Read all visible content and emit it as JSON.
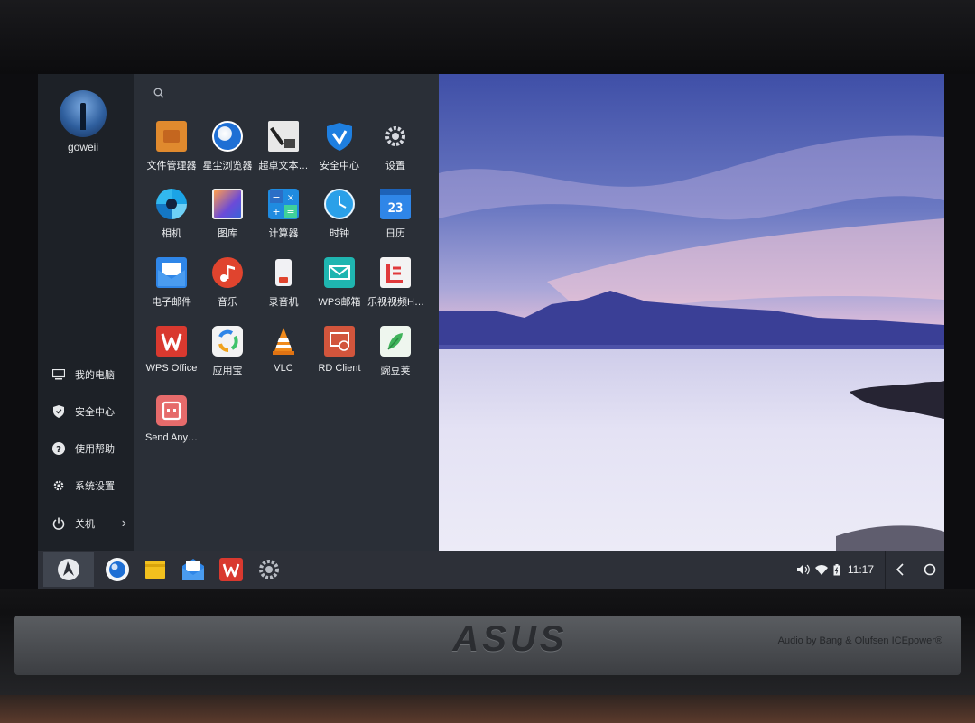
{
  "user": {
    "name": "goweii"
  },
  "apps": [
    {
      "label": "文件管理器",
      "icon": "folder-icon",
      "color": "#e08a2e"
    },
    {
      "label": "星尘浏览器",
      "icon": "globe-icon",
      "color": "#1e6fd4"
    },
    {
      "label": "超卓文本…",
      "icon": "text-editor-icon",
      "color": "#e8e8e8"
    },
    {
      "label": "安全中心",
      "icon": "shield-icon",
      "color": "#1e7fe0"
    },
    {
      "label": "设置",
      "icon": "gear-icon",
      "color": "#3a3f47"
    },
    {
      "label": "相机",
      "icon": "camera-icon",
      "color": "#1ba4e6"
    },
    {
      "label": "图库",
      "icon": "gallery-icon",
      "color": "#6b4bd8"
    },
    {
      "label": "计算器",
      "icon": "calculator-icon",
      "color": "#1f8be0"
    },
    {
      "label": "时钟",
      "icon": "clock-icon",
      "color": "#2aa0e8"
    },
    {
      "label": "日历",
      "icon": "calendar-icon",
      "color": "#2f86e8"
    },
    {
      "label": "电子邮件",
      "icon": "mail-icon",
      "color": "#2f86e8"
    },
    {
      "label": "音乐",
      "icon": "music-icon",
      "color": "#e0442e"
    },
    {
      "label": "录音机",
      "icon": "recorder-icon",
      "color": "#e8e8ee"
    },
    {
      "label": "WPS邮箱",
      "icon": "wps-mail-icon",
      "color": "#1fb5b0"
    },
    {
      "label": "乐视视频H…",
      "icon": "letv-icon",
      "color": "#f3f3f3"
    },
    {
      "label": "WPS Office",
      "icon": "wps-office-icon",
      "color": "#d9392f"
    },
    {
      "label": "应用宝",
      "icon": "app-store-icon",
      "color": "#f3f3f3"
    },
    {
      "label": "VLC",
      "icon": "vlc-cone-icon",
      "color": "#f08a1c"
    },
    {
      "label": "RD Client",
      "icon": "remote-desktop-icon",
      "color": "#d2553c"
    },
    {
      "label": "豌豆荚",
      "icon": "wandoujia-icon",
      "color": "#eef6ee"
    },
    {
      "label": "Send Any…",
      "icon": "send-anywhere-icon",
      "color": "#e66b6b"
    }
  ],
  "sidebar": {
    "items": [
      {
        "label": "我的电脑",
        "icon": "computer-icon"
      },
      {
        "label": "安全中心",
        "icon": "shield-icon"
      },
      {
        "label": "使用帮助",
        "icon": "help-icon"
      },
      {
        "label": "系统设置",
        "icon": "gear-icon"
      },
      {
        "label": "关机",
        "icon": "power-icon"
      }
    ]
  },
  "taskbar": {
    "pinned": [
      "globe-icon",
      "folder-icon",
      "mail-icon",
      "wps-office-icon",
      "gear-icon"
    ],
    "time": "11:17"
  },
  "bezel": {
    "brand": "ASUS",
    "audio": "Audio by Bang & Olufsen ICEpower®"
  }
}
